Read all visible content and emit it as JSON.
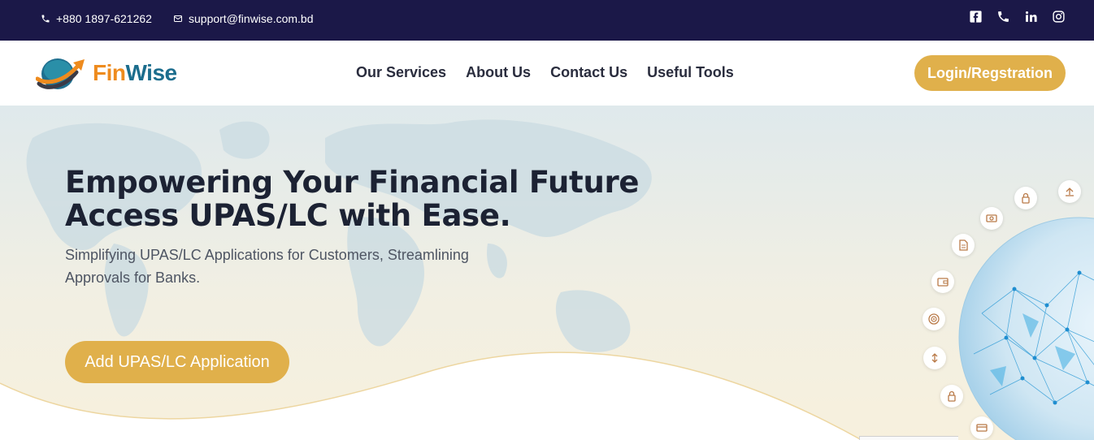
{
  "topbar": {
    "phone": "+880 1897-621262",
    "email": "support@finwise.com.bd",
    "social": [
      "facebook-icon",
      "phone-icon",
      "linkedin-icon",
      "instagram-icon"
    ]
  },
  "header": {
    "brand_part1": "Fin",
    "brand_part2": "Wise",
    "nav": [
      "Our Services",
      "About Us",
      "Contact Us",
      "Useful Tools"
    ],
    "login_label": "Login/Regstration"
  },
  "hero": {
    "headline_line1": "Empowering Your Financial Future",
    "headline_line2": "Access UPAS/LC with Ease.",
    "subtext": "Simplifying UPAS/LC Applications for Customers, Streamlining Approvals for Banks.",
    "cta_label": "Add UPAS/LC Application"
  },
  "colors": {
    "topbar": "#1b1848",
    "accent": "#e0b04b",
    "brand_orange": "#ee8b1e",
    "brand_teal": "#1c6d8d",
    "heading": "#1c2233"
  }
}
